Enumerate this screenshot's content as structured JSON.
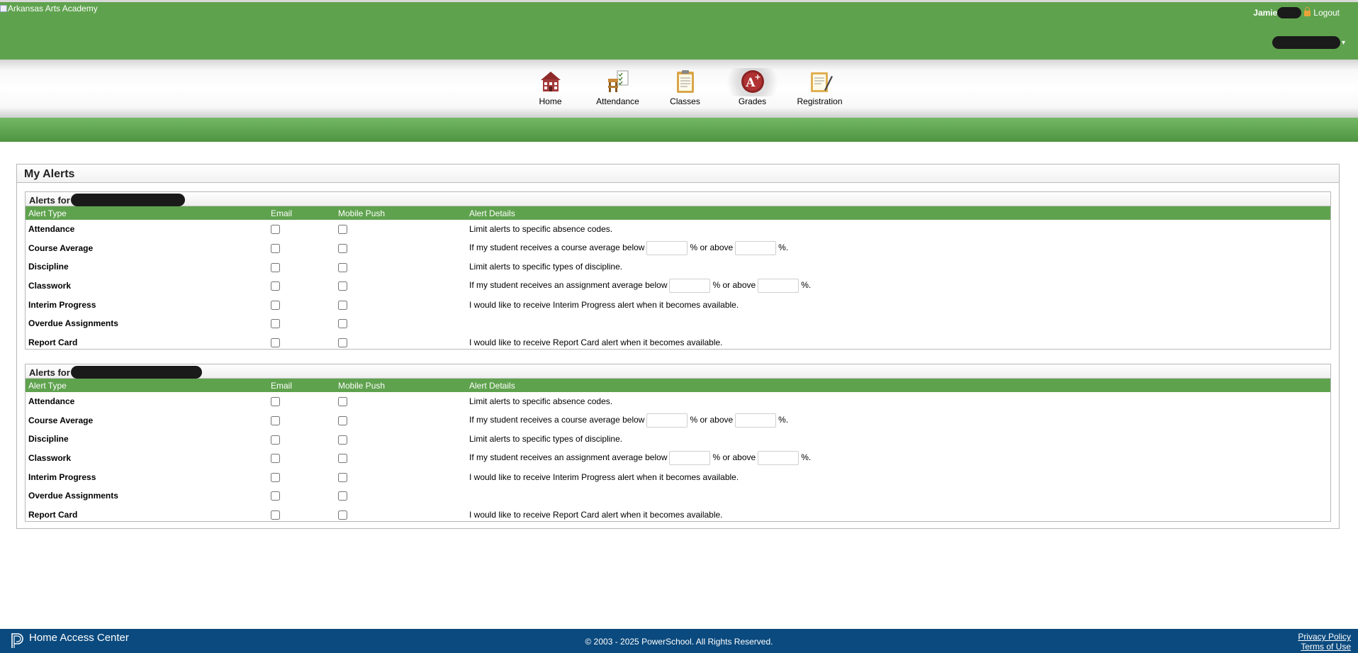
{
  "header": {
    "logo_alt": "Arkansas Arts Academy",
    "user_name": "Jamie",
    "logout_label": "Logout"
  },
  "nav": {
    "items": [
      {
        "label": "Home",
        "icon": "house-icon"
      },
      {
        "label": "Attendance",
        "icon": "desk-checklist-icon"
      },
      {
        "label": "Classes",
        "icon": "clipboard-icon"
      },
      {
        "label": "Grades",
        "icon": "a-plus-grade-icon",
        "active": true
      },
      {
        "label": "Registration",
        "icon": "pencil-form-icon"
      }
    ]
  },
  "panel": {
    "title": "My Alerts",
    "students": [
      {
        "heading": "Alerts for",
        "columns": [
          "Alert Type",
          "Email",
          "Mobile Push",
          "Alert Details"
        ],
        "rows": [
          {
            "type": "Attendance",
            "details": "Limit alerts to specific absence codes."
          },
          {
            "type": "Course Average",
            "details_prefix": "If my student receives a course average below",
            "mid": "% or above",
            "suffix": "%."
          },
          {
            "type": "Discipline",
            "details": "Limit alerts to specific types of discipline."
          },
          {
            "type": "Classwork",
            "details_prefix": "If my student receives an assignment average below",
            "mid": "% or above",
            "suffix": "%."
          },
          {
            "type": "Interim Progress",
            "details": "I would like to receive Interim Progress alert when it becomes available."
          },
          {
            "type": "Overdue Assignments",
            "details": ""
          },
          {
            "type": "Report Card",
            "details": "I would like to receive Report Card alert when it becomes available."
          }
        ]
      },
      {
        "heading": "Alerts for",
        "columns": [
          "Alert Type",
          "Email",
          "Mobile Push",
          "Alert Details"
        ],
        "rows": [
          {
            "type": "Attendance",
            "details": "Limit alerts to specific absence codes."
          },
          {
            "type": "Course Average",
            "details_prefix": "If my student receives a course average below",
            "mid": "% or above",
            "suffix": "%."
          },
          {
            "type": "Discipline",
            "details": "Limit alerts to specific types of discipline."
          },
          {
            "type": "Classwork",
            "details_prefix": "If my student receives an assignment average below",
            "mid": "% or above",
            "suffix": "%."
          },
          {
            "type": "Interim Progress",
            "details": "I would like to receive Interim Progress alert when it becomes available."
          },
          {
            "type": "Overdue Assignments",
            "details": ""
          },
          {
            "type": "Report Card",
            "details": "I would like to receive Report Card alert when it becomes available."
          }
        ]
      }
    ]
  },
  "footer": {
    "app_name": "Home Access Center",
    "copyright": "© 2003 - 2025 PowerSchool. All Rights Reserved.",
    "privacy": "Privacy Policy",
    "terms": "Terms of Use"
  },
  "colors": {
    "brand_green": "#5fa24e",
    "footer_blue": "#0b4a7e"
  }
}
